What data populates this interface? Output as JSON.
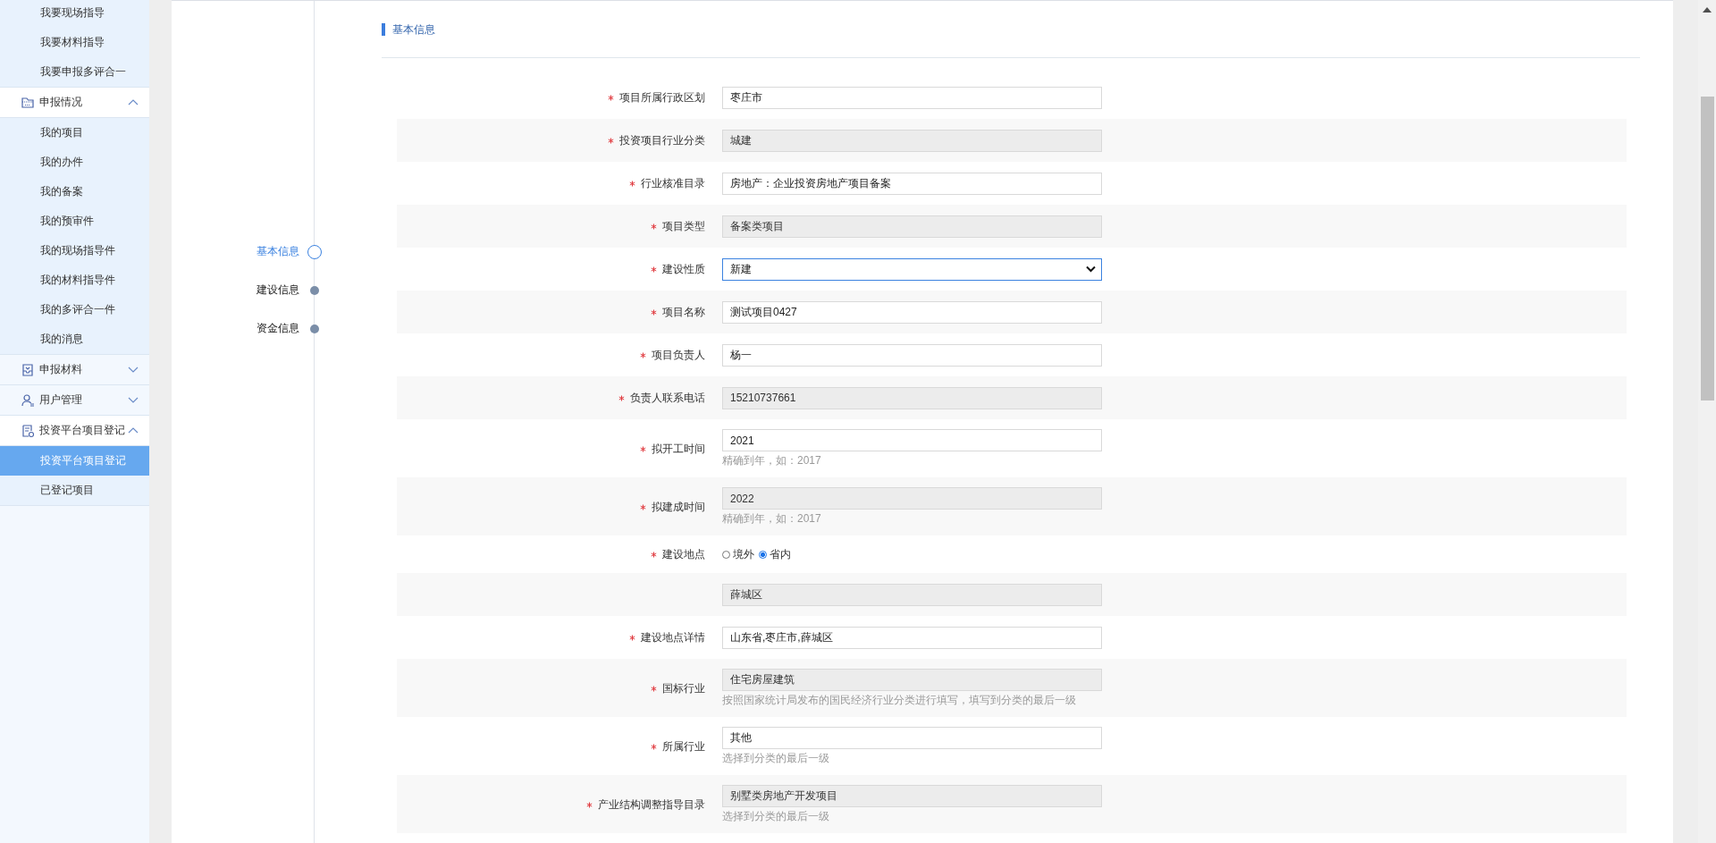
{
  "sidebar": {
    "top_items": [
      {
        "label": "我要现场指导",
        "selected": false
      },
      {
        "label": "我要材料指导",
        "selected": false
      },
      {
        "label": "我要申报多评合一",
        "selected": false
      }
    ],
    "groups": [
      {
        "label": "申报情况",
        "kind": "folder",
        "expanded": true,
        "children": [
          {
            "label": "我的项目",
            "selected": false
          },
          {
            "label": "我的办件",
            "selected": false
          },
          {
            "label": "我的备案",
            "selected": false
          },
          {
            "label": "我的预审件",
            "selected": false
          },
          {
            "label": "我的现场指导件",
            "selected": false
          },
          {
            "label": "我的材料指导件",
            "selected": false
          },
          {
            "label": "我的多评合一件",
            "selected": false
          },
          {
            "label": "我的消息",
            "selected": false
          }
        ]
      },
      {
        "label": "申报材料",
        "kind": "tray",
        "expanded": false
      },
      {
        "label": "用户管理",
        "kind": "user",
        "expanded": false
      },
      {
        "label": "投资平台项目登记",
        "kind": "document",
        "expanded": true,
        "children": [
          {
            "label": "投资平台项目登记",
            "selected": true
          },
          {
            "label": "已登记项目",
            "selected": false
          }
        ]
      }
    ]
  },
  "steps": [
    {
      "label": "基本信息",
      "selected": true
    },
    {
      "label": "建设信息",
      "selected": false
    },
    {
      "label": "资金信息",
      "selected": false
    }
  ],
  "section": {
    "title": "基本信息"
  },
  "fields": [
    {
      "kind": "text",
      "label": "项目所属行政区划",
      "required": true,
      "readonly": false,
      "value": "枣庄市"
    },
    {
      "kind": "text",
      "label": "投资项目行业分类",
      "required": true,
      "readonly": true,
      "value": "城建"
    },
    {
      "kind": "text",
      "label": "行业核准目录",
      "required": true,
      "readonly": false,
      "value": "房地产：企业投资房地产项目备案"
    },
    {
      "kind": "text",
      "label": "项目类型",
      "required": true,
      "readonly": true,
      "value": "备案类项目"
    },
    {
      "kind": "select",
      "label": "建设性质",
      "required": true,
      "value": "新建"
    },
    {
      "kind": "text",
      "label": "项目名称",
      "required": true,
      "readonly": false,
      "value": "测试项目0427"
    },
    {
      "kind": "text",
      "label": "项目负责人",
      "required": true,
      "readonly": false,
      "value": "杨一"
    },
    {
      "kind": "text",
      "label": "负责人联系电话",
      "required": true,
      "readonly": true,
      "value": "15210737661"
    },
    {
      "kind": "text",
      "label": "拟开工时间",
      "required": true,
      "readonly": false,
      "value": "2021",
      "hint": "精确到年，如：2017"
    },
    {
      "kind": "text",
      "label": "拟建成时间",
      "required": true,
      "readonly": true,
      "value": "2022",
      "hint": "精确到年，如：2017"
    },
    {
      "kind": "radio",
      "label": "建设地点",
      "required": true,
      "options": [
        {
          "label": "境外",
          "selected": false
        },
        {
          "label": "省内",
          "selected": true
        }
      ]
    },
    {
      "kind": "text",
      "required": false,
      "readonly": true,
      "value": "薛城区"
    },
    {
      "kind": "text",
      "label": "建设地点详情",
      "required": true,
      "readonly": false,
      "value": "山东省,枣庄市,薛城区"
    },
    {
      "kind": "text",
      "label": "国标行业",
      "required": true,
      "readonly": true,
      "value": "住宅房屋建筑",
      "hint": "按照国家统计局发布的国民经济行业分类进行填写，填写到分类的最后一级"
    },
    {
      "kind": "text",
      "label": "所属行业",
      "required": true,
      "readonly": false,
      "value": "其他",
      "hint": "选择到分类的最后一级"
    },
    {
      "kind": "text",
      "label": "产业结构调整指导目录",
      "required": true,
      "readonly": true,
      "value": "别墅类房地产开发项目",
      "hint": "选择到分类的最后一级"
    }
  ]
}
